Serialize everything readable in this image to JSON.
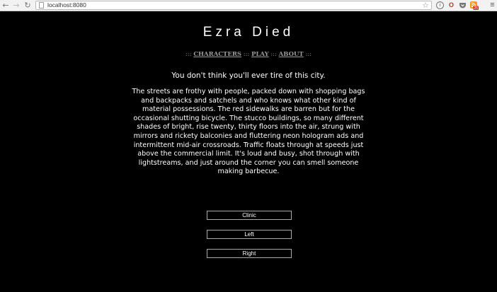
{
  "browser": {
    "url": "localhost:8080",
    "badge_count": "25"
  },
  "page": {
    "title": "Ezra Died",
    "menu": {
      "separator": ":::",
      "items": [
        "CHARACTERS",
        "PLAY",
        "ABOUT"
      ]
    },
    "lead": "You don't think you'll ever tire of this city.",
    "story": "The streets are frothy with people, packed down with shopping bags and backpacks and satchels and who knows what other kind of material possessions. The red sidewalks are barren but for the occasional shutting bicycle. The stucco buildings, so many different shades of bright, rise twenty, thirty floors into the air, strung with mirrors and rickety balconies and fluttering neon hologram ads and intermittent mid-air crossroads. Traffic floats through at speeds just above the commercial limit. It's loud and busy, shot through with lightstreams, and just around the corner you can smell someone making barbecue.",
    "choices": [
      "Clinic",
      "Left",
      "Right"
    ]
  }
}
